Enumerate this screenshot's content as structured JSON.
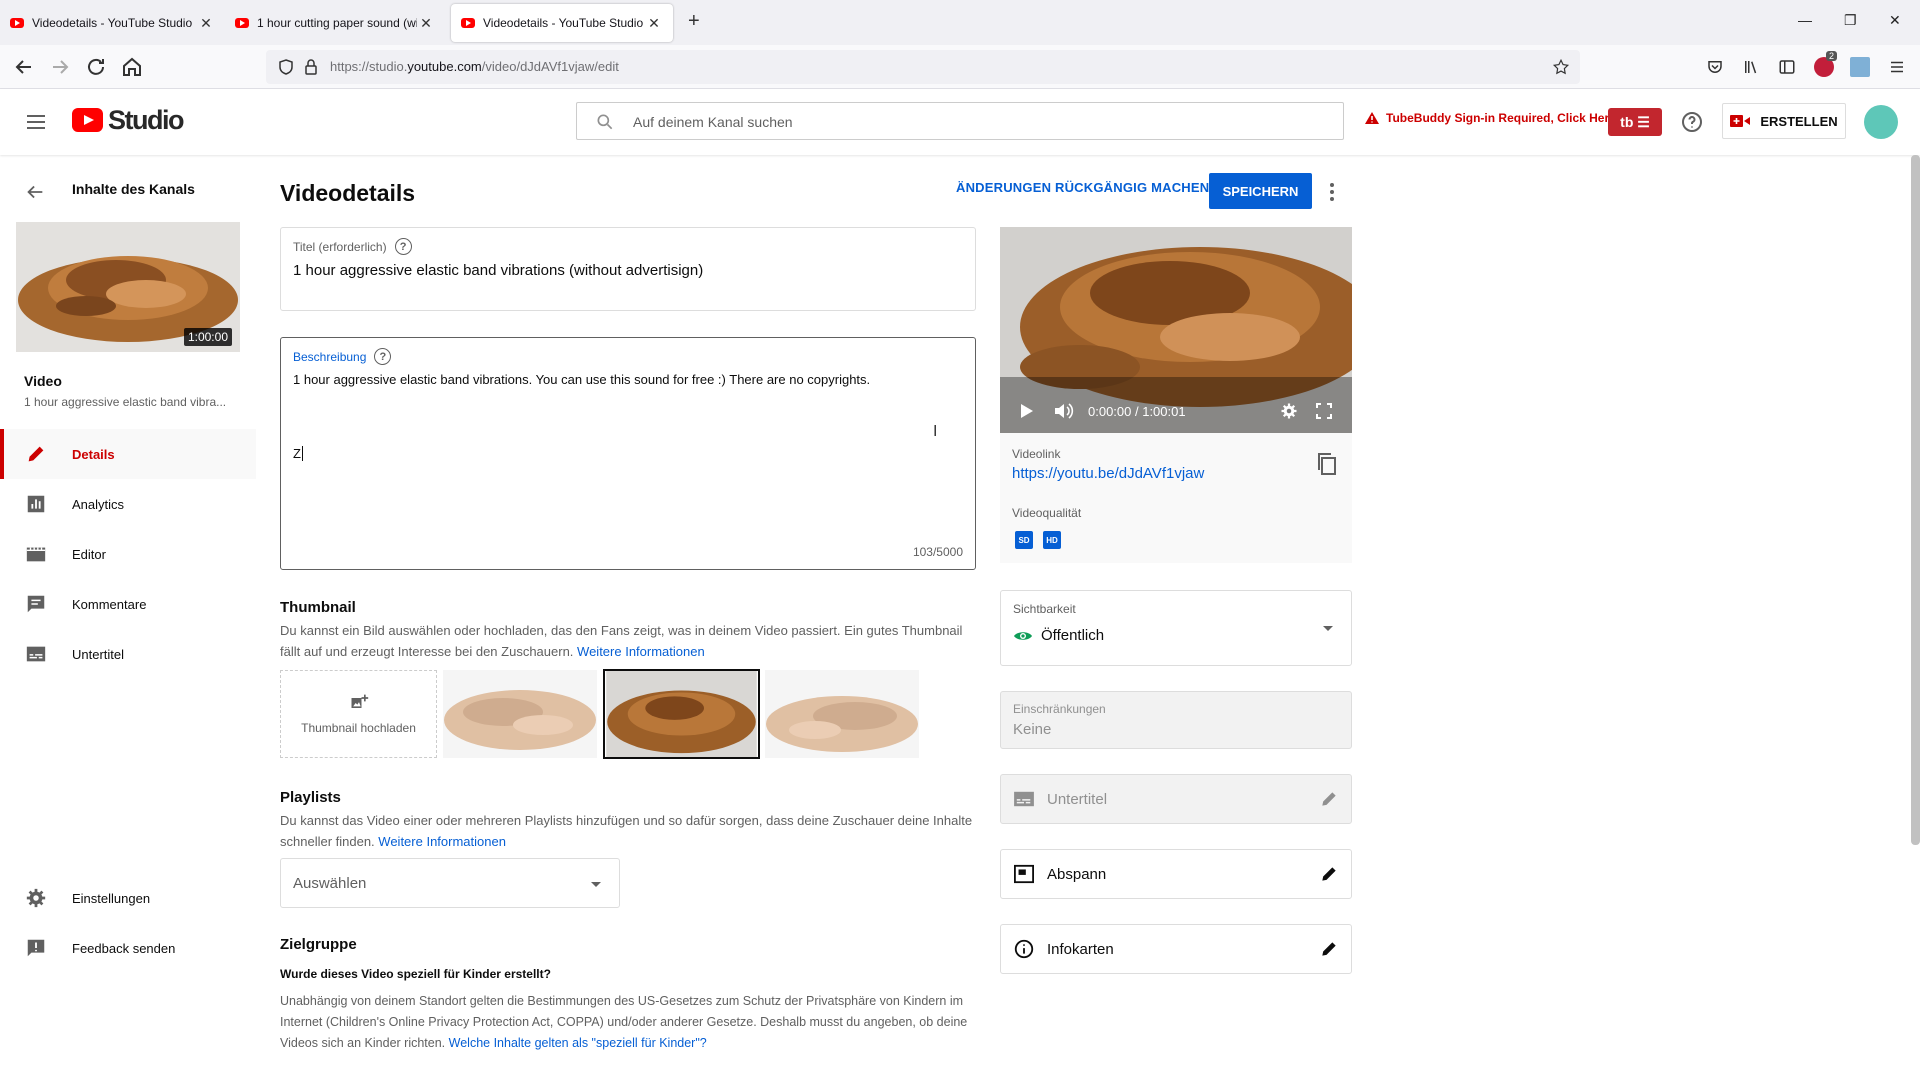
{
  "browser": {
    "tabs": [
      {
        "label": "Videodetails - YouTube Studio",
        "active": false
      },
      {
        "label": "1 hour cutting paper sound (wit",
        "active": false
      },
      {
        "label": "Videodetails - YouTube Studio",
        "active": true
      }
    ],
    "new_tab": "+",
    "url_prefix": "https://studio.",
    "url_domain": "youtube.com",
    "url_path": "/video/dJdAVf1vjaw/edit",
    "ext_badge": "2"
  },
  "header": {
    "logo_text": "Studio",
    "search_placeholder": "Auf deinem Kanal suchen",
    "tubebuddy_warning": "TubeBuddy Sign-in Required, Click Here",
    "tubebuddy_btn": "tb",
    "create_label": "ERSTELLEN"
  },
  "sidebar": {
    "back_title": "Inhalte des Kanals",
    "thumb_duration": "1:00:00",
    "video_label": "Video",
    "video_title": "1 hour aggressive elastic band vibra...",
    "items": [
      {
        "label": "Details",
        "icon": "pencil-icon",
        "active": true
      },
      {
        "label": "Analytics",
        "icon": "bar-chart-icon",
        "active": false
      },
      {
        "label": "Editor",
        "icon": "film-icon",
        "active": false
      },
      {
        "label": "Kommentare",
        "icon": "comment-icon",
        "active": false
      },
      {
        "label": "Untertitel",
        "icon": "subtitles-icon",
        "active": false
      }
    ],
    "bottom_items": [
      {
        "label": "Einstellungen",
        "icon": "gear-icon"
      },
      {
        "label": "Feedback senden",
        "icon": "feedback-icon"
      }
    ]
  },
  "main": {
    "title": "Videodetails",
    "undo_label": "ÄNDERUNGEN RÜCKGÄNGIG MACHEN",
    "save_label": "SPEICHERN",
    "title_field": {
      "label": "Titel (erforderlich)",
      "value": "1 hour aggressive elastic band vibrations (without advertisign)"
    },
    "description_field": {
      "label": "Beschreibung",
      "line1": "1 hour aggressive elastic band vibrations. You can use this sound for free :) There are no copyrights.",
      "line2": "Z",
      "counter": "103/5000"
    },
    "thumbnail": {
      "heading": "Thumbnail",
      "text": "Du kannst ein Bild auswählen oder hochladen, das den Fans zeigt, was in deinem Video passiert. Ein gutes Thumbnail fällt auf und erzeugt Interesse bei den Zuschauern.",
      "link": "Weitere Informationen",
      "upload_label": "Thumbnail hochladen",
      "selected_index": 1
    },
    "playlists": {
      "heading": "Playlists",
      "text": "Du kannst das Video einer oder mehreren Playlists hinzufügen und so dafür sorgen, dass deine Zuschauer deine Inhalte schneller finden.",
      "link": "Weitere Informationen",
      "select_value": "Auswählen"
    },
    "audience": {
      "heading": "Zielgruppe",
      "question": "Wurde dieses Video speziell für Kinder erstellt?",
      "text": "Unabhängig von deinem Standort gelten die Bestimmungen des US-Gesetzes zum Schutz der Privatsphäre von Kindern im Internet (Children's Online Privacy Protection Act, COPPA) und/oder anderer Gesetze. Deshalb musst du angeben, ob deine Videos sich an Kinder richten.",
      "link": "Welche Inhalte gelten als \"speziell für Kinder\"?"
    }
  },
  "right_panel": {
    "player_time": "0:00:00 / 1:00:01",
    "video_link_label": "Videolink",
    "video_link": "https://youtu.be/dJdAVf1vjaw",
    "quality_label": "Videoqualität",
    "quality_badges": [
      "SD",
      "HD"
    ],
    "visibility_label": "Sichtbarkeit",
    "visibility_value": "Öffentlich",
    "restrictions_label": "Einschränkungen",
    "restrictions_value": "Keine",
    "subtitles_label": "Untertitel",
    "endscreen_label": "Abspann",
    "cards_label": "Infokarten"
  },
  "colors": {
    "accent_blue": "#065fd4",
    "brand_red": "#ff0000",
    "active_red": "#cc0000",
    "public_green": "#0f9d58"
  }
}
